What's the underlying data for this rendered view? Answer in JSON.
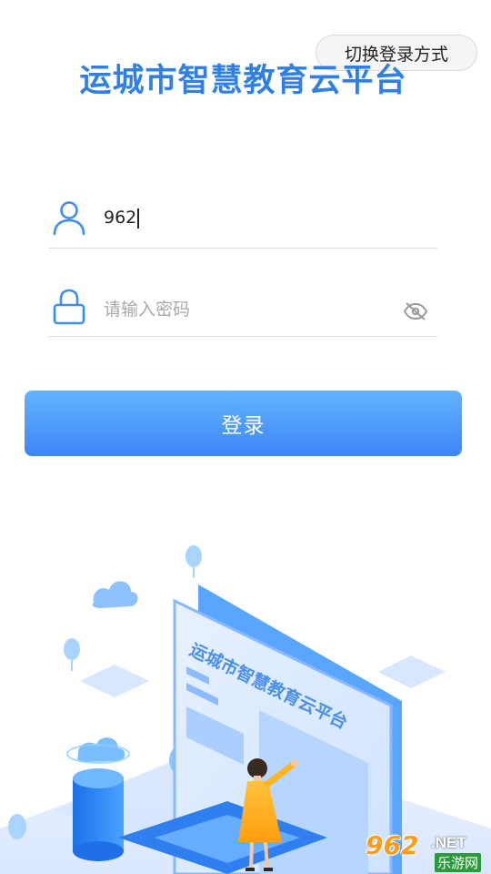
{
  "header": {
    "switch_login_label": "切换登录方式",
    "app_title": "运城市智慧教育云平台"
  },
  "form": {
    "username": {
      "icon": "user-icon",
      "value": "962"
    },
    "password": {
      "icon": "lock-icon",
      "placeholder": "请输入密码",
      "toggle_icon": "eye-off-icon"
    },
    "login_label": "登录"
  },
  "illustration": {
    "board_text": "运城市智慧教育云平台"
  },
  "watermark": {
    "brand_number": "962",
    "brand_suffix": ".NET",
    "brand_name": "乐游网"
  },
  "colors": {
    "title_blue": "#2f7fe6",
    "button_gradient_top": "#62b3ff",
    "button_gradient_bottom": "#3d86f6",
    "icon_blue": "#3a8ff0"
  }
}
